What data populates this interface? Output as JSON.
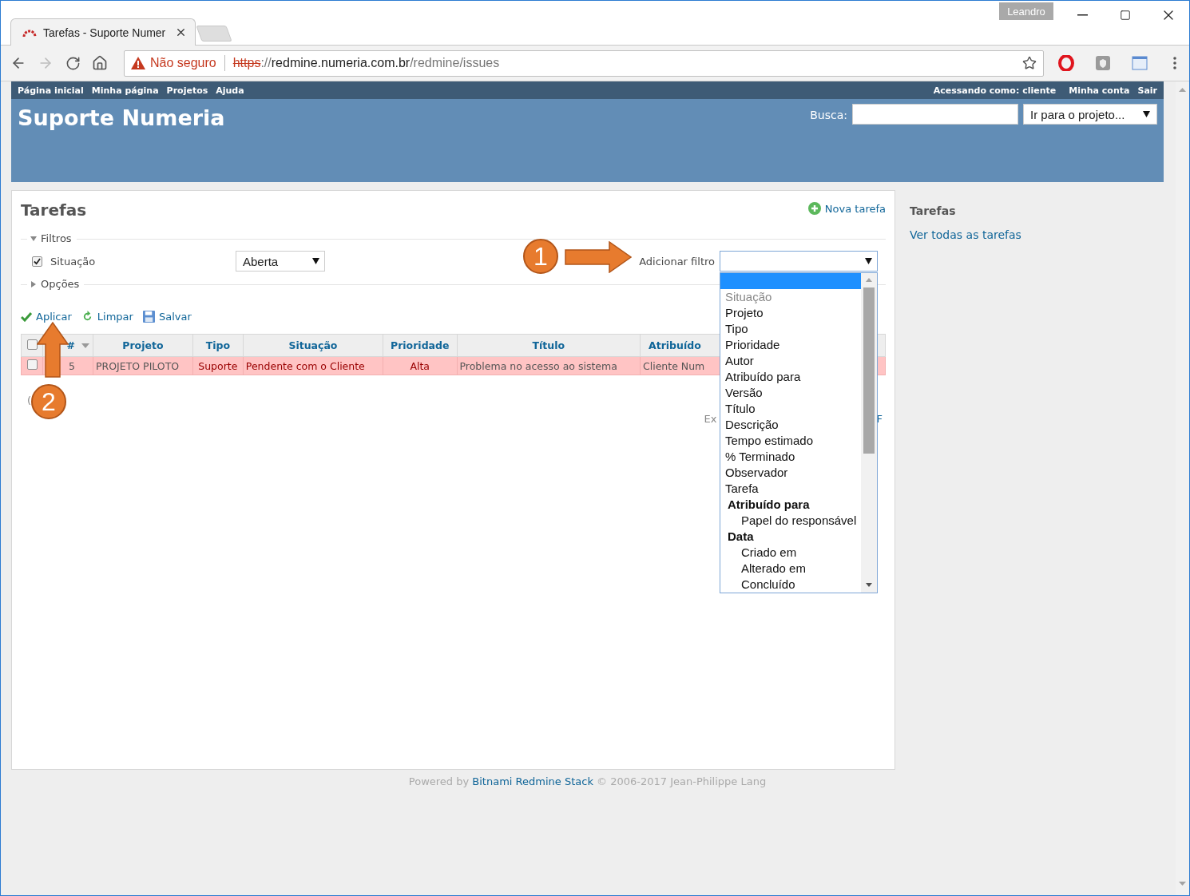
{
  "browser": {
    "tab_title": "Tarefas - Suporte Numer",
    "profile": "Leandro",
    "forward_disabled": true,
    "security": "Não seguro",
    "url": {
      "scheme": "https",
      "separator": "://",
      "host": "redmine.numeria.com.br",
      "path": "/redmine/issues"
    }
  },
  "top_menu": {
    "left": [
      "Página inicial",
      "Minha página",
      "Projetos",
      "Ajuda"
    ],
    "logged_as_label": "Acessando como:",
    "user": "cliente",
    "right": [
      "Minha conta",
      "Sair"
    ]
  },
  "header": {
    "title": "Suporte Numeria",
    "search_label": "Busca:",
    "project_jump": "Ir para o projeto..."
  },
  "main": {
    "title": "Tarefas",
    "new_issue": "Nova tarefa",
    "filters": {
      "legend": "Filtros",
      "expanded": true,
      "rows": [
        {
          "label": "Situação",
          "checked": true,
          "operator": "Aberta"
        }
      ],
      "add_filter_label": "Adicionar filtro",
      "dropdown": [
        {
          "kind": "blank",
          "selected": true,
          "disabled": false
        },
        {
          "kind": "option",
          "label": "Situação",
          "selected": false,
          "disabled": true
        },
        {
          "kind": "option",
          "label": "Projeto",
          "selected": false,
          "disabled": false
        },
        {
          "kind": "option",
          "label": "Tipo",
          "selected": false,
          "disabled": false
        },
        {
          "kind": "option",
          "label": "Prioridade",
          "selected": false,
          "disabled": false
        },
        {
          "kind": "option",
          "label": "Autor",
          "selected": false,
          "disabled": false
        },
        {
          "kind": "option",
          "label": "Atribuído para",
          "selected": false,
          "disabled": false
        },
        {
          "kind": "option",
          "label": "Versão",
          "selected": false,
          "disabled": false
        },
        {
          "kind": "option",
          "label": "Título",
          "selected": false,
          "disabled": false
        },
        {
          "kind": "option",
          "label": "Descrição",
          "selected": false,
          "disabled": false
        },
        {
          "kind": "option",
          "label": "Tempo estimado",
          "selected": false,
          "disabled": false
        },
        {
          "kind": "option",
          "label": "% Terminado",
          "selected": false,
          "disabled": false
        },
        {
          "kind": "option",
          "label": "Observador",
          "selected": false,
          "disabled": false
        },
        {
          "kind": "option",
          "label": "Tarefa",
          "selected": false,
          "disabled": false
        },
        {
          "kind": "group",
          "label": "Atribuído para",
          "children": [
            {
              "label": "Papel do responsável",
              "selected": false
            }
          ]
        },
        {
          "kind": "group",
          "label": "Data",
          "children": [
            {
              "label": "Criado em",
              "selected": false
            },
            {
              "label": "Alterado em",
              "selected": false
            },
            {
              "label": "Concluído",
              "selected": false
            }
          ]
        }
      ]
    },
    "options": {
      "legend": "Opções",
      "expanded": false
    },
    "actions": [
      {
        "kind": "apply",
        "label": "Aplicar"
      },
      {
        "kind": "clear",
        "label": "Limpar"
      },
      {
        "kind": "save",
        "label": "Salvar"
      }
    ],
    "table": {
      "all_checked": false,
      "columns": [
        "#",
        "Projeto",
        "Tipo",
        "Situação",
        "Prioridade",
        "Título",
        "Atribuído"
      ],
      "rows": [
        {
          "checked": false,
          "cells": [
            {
              "text": "5",
              "emphasis": false
            },
            {
              "text": "PROJETO PILOTO",
              "emphasis": false
            },
            {
              "text": "Suporte",
              "emphasis": true
            },
            {
              "text": "Pendente com o Cliente",
              "emphasis": true
            },
            {
              "text": "Alta",
              "emphasis": true
            },
            {
              "text": "Problema no acesso ao sistema",
              "emphasis": false
            },
            {
              "text": "Cliente Num",
              "emphasis": false
            }
          ]
        }
      ]
    },
    "count_text": "(",
    "export": [
      "Ex",
      "F"
    ]
  },
  "sidebar": {
    "title": "Tarefas",
    "links": [
      "Ver todas as tarefas"
    ]
  },
  "footer": {
    "prefix": "Powered by",
    "link": "Bitnami Redmine Stack",
    "suffix": "© 2006-2017 Jean-Philippe Lang"
  },
  "annotations": [
    {
      "label": "1"
    },
    {
      "label": "2"
    }
  ]
}
